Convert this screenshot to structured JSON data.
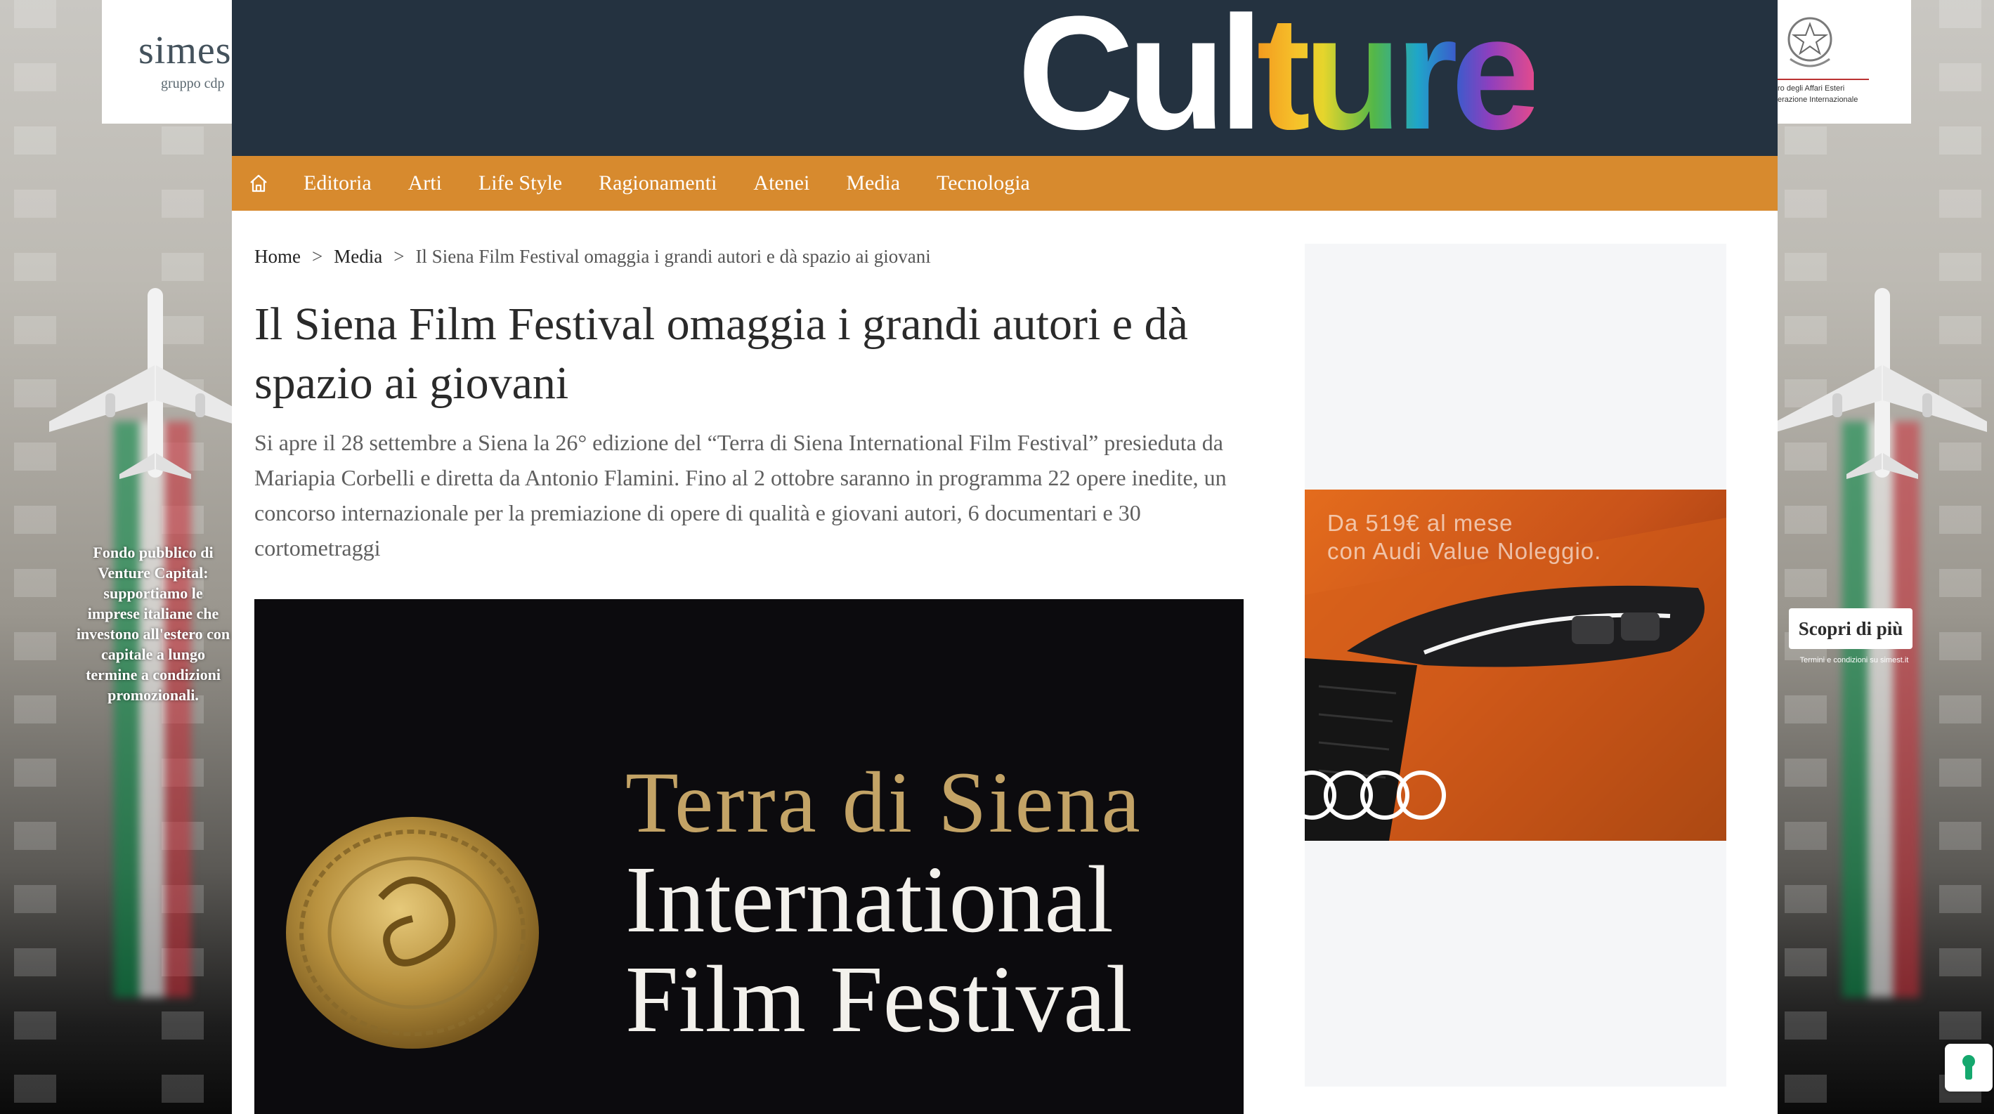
{
  "skin": {
    "left_brand": "simest",
    "left_brand_sub": "gruppo cdp",
    "left_copy": "Fondo pubblico di Venture Capital: supportiamo le imprese italiane che investono all'estero con capitale a lungo termine a condizioni promozionali.",
    "right_org_line1": "ro degli Affari Esteri",
    "right_org_line2": "erazione Internazionale",
    "cta_label": "Scopri di più",
    "cta_terms": "Termini e condizioni su simest.it"
  },
  "site": {
    "logo_plain": "Cul",
    "logo_colored": "ture"
  },
  "nav": {
    "items": [
      "Editoria",
      "Arti",
      "Life Style",
      "Ragionamenti",
      "Atenei",
      "Media",
      "Tecnologia"
    ]
  },
  "breadcrumb": {
    "home": "Home",
    "section": "Media",
    "current": "Il Siena Film Festival omaggia i grandi autori e dà spazio ai giovani",
    "sep": ">"
  },
  "article": {
    "title": "Il Siena Film Festival omaggia i grandi autori e dà spazio ai giovani",
    "lead": "Si apre il 28 settembre a Siena la 26° edizione del “Terra di Siena International Film Festival” presieduta da Mariapia Corbelli e diretta da Antonio Flamini. Fino al 2 ottobre saranno in programma 22 opere inedite, un concorso internazionale per la premiazione di opere di qualità e giovani autori, 6 documentari e 30 cortometraggi",
    "hero_line1": "Terra di Siena",
    "hero_line2": "International",
    "hero_line3": "Film Festival"
  },
  "sidebar_ad": {
    "line1": "Da 519€ al mese",
    "line2": "con Audi Value Noleggio."
  },
  "colors": {
    "masthead": "#243240",
    "navbar": "#d78a2e",
    "hero_gold": "#c3a366"
  }
}
